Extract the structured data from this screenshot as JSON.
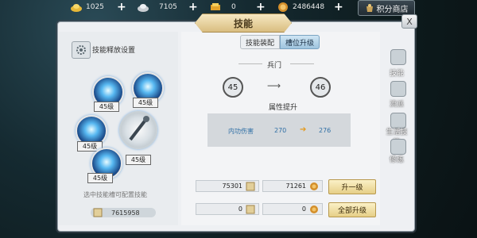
{
  "currency": {
    "gold": "1025",
    "silver": "7105",
    "ingot": "0",
    "coins": "2486448",
    "shop_label": "积分商店"
  },
  "window": {
    "title": "技能",
    "close_label": "X"
  },
  "left": {
    "settings_label": "技能释放设置",
    "skills": [
      {
        "name": "skill-1",
        "level": "45级"
      },
      {
        "name": "skill-2",
        "level": "45级"
      },
      {
        "name": "skill-3",
        "level": "45级"
      },
      {
        "name": "skill-4",
        "level": "45级"
      },
      {
        "name": "skill-5",
        "level": "45级"
      }
    ],
    "hint": "选中技能槽可配置技能",
    "points": "7615958"
  },
  "tabs": {
    "equip": "技能装配",
    "upgrade": "槽位升级"
  },
  "section": {
    "title": "兵门",
    "level_from": "45",
    "level_to": "46",
    "attr_title": "属性提升",
    "attr_name": "内功伤害",
    "attr_from": "270",
    "attr_to": "276"
  },
  "costs": {
    "row1_a": "75301",
    "row1_b": "71261",
    "row2_a": "0",
    "row2_b": "0",
    "upgrade_one": "升一级",
    "upgrade_all": "全部升级"
  },
  "side": {
    "tab_skill": "技能",
    "tab_school": "流派",
    "tab_life": "生活技能",
    "tab_cultivate": "修炼"
  },
  "colors": {
    "accent_gold": "#e6cf87",
    "attr_blue": "#2f6fa5",
    "arrow_orange": "#e49a1c"
  }
}
